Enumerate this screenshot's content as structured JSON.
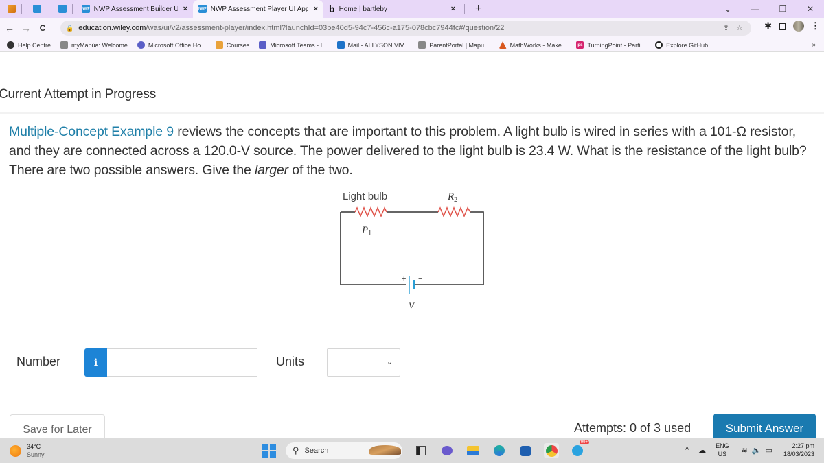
{
  "browser": {
    "tabs": [
      {
        "title": "NWP Assessment Builder UI App",
        "favicon": "nwp-icon",
        "active": false
      },
      {
        "title": "NWP Assessment Player UI Appli",
        "favicon": "nwp-icon",
        "active": true
      },
      {
        "title": "Home | bartleby",
        "favicon": "bartleby-icon",
        "active": false
      }
    ],
    "pinned_tabs": [
      "courses-icon",
      "nwp-icon",
      "nwp-icon"
    ],
    "tab_close_glyph": "×",
    "new_tab_glyph": "+",
    "window_controls": {
      "tab_search": "⌄",
      "minimize": "—",
      "restore": "❐",
      "close": "✕"
    },
    "nav": {
      "back": "←",
      "forward": "→",
      "reload": "C"
    },
    "url_host": "education.wiley.com",
    "url_path": "/was/ui/v2/assessment-player/index.html?launchId=03be40d5-94c7-456c-a175-078cbc7944fc#/question/22",
    "bookmarks": [
      {
        "label": "Help Centre",
        "icon": "globe-icon",
        "color": "#333333"
      },
      {
        "label": "myMapúa: Welcome",
        "icon": "mapua-icon",
        "color": "#6b6b6b"
      },
      {
        "label": "Microsoft Office Ho...",
        "icon": "office-icon",
        "color": "#5b5fc7"
      },
      {
        "label": "Courses",
        "icon": "courses-icon",
        "color": "#e9a23b"
      },
      {
        "label": "Microsoft Teams - I...",
        "icon": "teams-icon",
        "color": "#5b5fc7"
      },
      {
        "label": "Mail - ALLYSON VIV...",
        "icon": "outlook-icon",
        "color": "#1e73c8"
      },
      {
        "label": "ParentPortal | Mapu...",
        "icon": "mapua-icon",
        "color": "#6b6b6b"
      },
      {
        "label": "MathWorks - Make...",
        "icon": "mathworks-icon",
        "color": "#d9581e"
      },
      {
        "label": "TurningPoint - Parti...",
        "icon": "turningpoint-icon",
        "color": "#d6246e"
      },
      {
        "label": "Explore GitHub",
        "icon": "github-icon",
        "color": "#222222"
      }
    ],
    "bookmarks_overflow": "»"
  },
  "page": {
    "attempt_title": "Current Attempt in Progress",
    "question": {
      "link_text": "Multiple-Concept Example 9",
      "text_1": " reviews the concepts that are important to this problem. A light bulb is wired in series with a 101-Ω resistor, and they are connected across a 120.0-V source. The power delivered to the light bulb is 23.4 W. What is the resistance of the light bulb? There are two possible answers. Give the ",
      "emphasis": "larger",
      "text_2": " of the two."
    },
    "figure": {
      "bulb_label": "Light bulb",
      "power_label": "P",
      "power_sub": "1",
      "resistor_label": "R",
      "resistor_sub": "2",
      "battery_plus": "+",
      "battery_minus": "−",
      "voltage_label": "V",
      "resistor_color": "#e0534a",
      "battery_color": "#2a9fd6",
      "wire_color": "#333333"
    },
    "answer": {
      "number_label": "Number",
      "info_glyph": "i",
      "number_value": "",
      "units_label": "Units",
      "units_value": ""
    },
    "save_label": "Save for Later",
    "attempts_text": "Attempts: 0 of 3 used",
    "submit_label": "Submit Answer"
  },
  "taskbar": {
    "weather_temp": "34°C",
    "weather_cond": "Sunny",
    "search_label": "Search",
    "telegram_badge": "99+",
    "lang_1": "ENG",
    "lang_2": "US",
    "time": "2:27 pm",
    "date": "18/03/2023"
  }
}
